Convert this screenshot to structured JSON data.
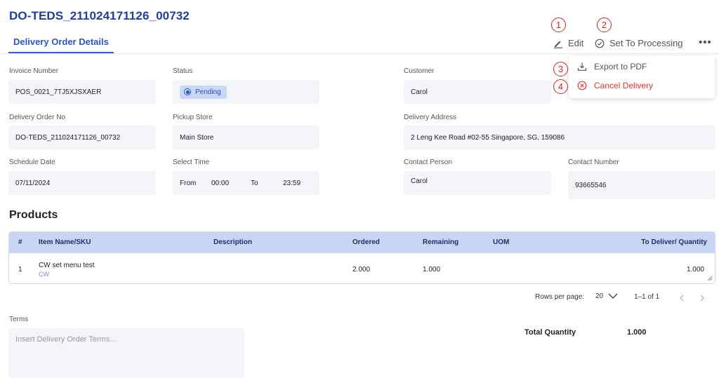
{
  "header": {
    "title": "DO-TEDS_211024171126_00732",
    "tab": "Delivery Order Details"
  },
  "toolbar": {
    "edit_label": "Edit",
    "processing_label": "Set To Processing",
    "more_label": "•••",
    "markers": [
      "1",
      "2",
      "3",
      "4"
    ]
  },
  "menu": {
    "export_label": "Export to PDF",
    "cancel_label": "Cancel Delivery"
  },
  "form": {
    "invoice_label": "Invoice Number",
    "invoice_value": "POS_0021_7TJ5XJSXAER",
    "status_label": "Status",
    "status_value": "Pending",
    "customer_label": "Customer",
    "customer_value": "Carol",
    "do_no_label": "Delivery Order No",
    "do_no_value": "DO-TEDS_211024171126_00732",
    "pickup_label": "Pickup Store",
    "pickup_value": "Main Store",
    "address_label": "Delivery Address",
    "address_value": "2 Leng Kee Road #02-55 Singapore, SG, 159086",
    "schedule_label": "Schedule Date",
    "schedule_value": "07/11/2024",
    "time_label": "Select Time",
    "time_from_label": "From",
    "time_from_value": "00:00",
    "time_to_label": "To",
    "time_to_value": "23:59",
    "contact_person_label": "Contact Person",
    "contact_person_value": "Carol",
    "contact_number_label": "Contact Number",
    "contact_number_value": "93665546"
  },
  "products": {
    "heading": "Products",
    "columns": [
      "#",
      "Item Name/SKU",
      "Description",
      "Ordered",
      "Remaining",
      "UOM",
      "To Deliver/ Quantity"
    ],
    "rows": [
      {
        "index": "1",
        "name": "CW set menu test",
        "sku": "CW",
        "description": "",
        "ordered": "2.000",
        "remaining": "1.000",
        "uom": "",
        "to_deliver": "1.000"
      }
    ]
  },
  "pagination": {
    "rows_per_page_label": "Rows per page:",
    "rows_per_page_value": "20",
    "range": "1–1 of 1"
  },
  "terms": {
    "label": "Terms",
    "placeholder": "Insert Delivery Order Terms..."
  },
  "totals": {
    "label": "Total Quantity",
    "value": "1.000"
  },
  "colors": {
    "primary": "#2c55c4",
    "title": "#1f3f9e",
    "danger": "#e0352b",
    "table_header": "#c7d6f4",
    "field_bg": "#f3f5f8"
  }
}
